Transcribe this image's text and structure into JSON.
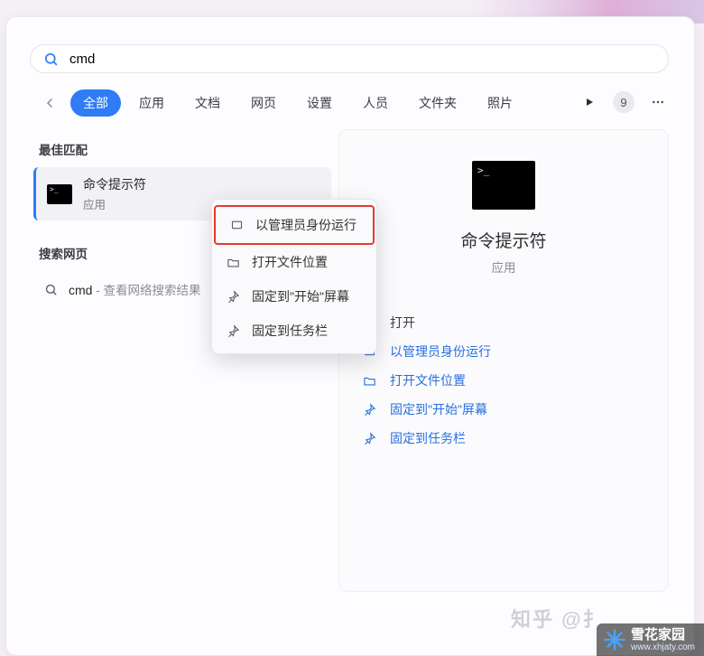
{
  "search": {
    "query": "cmd"
  },
  "filters": {
    "items": [
      "全部",
      "应用",
      "文档",
      "网页",
      "设置",
      "人员",
      "文件夹",
      "照片"
    ],
    "active_index": 0,
    "badge": "9"
  },
  "sections": {
    "best_match_title": "最佳匹配",
    "web_title": "搜索网页"
  },
  "best_match": {
    "title": "命令提示符",
    "subtitle": "应用"
  },
  "web_result": {
    "term": "cmd",
    "suffix": " - 查看网络搜索结果"
  },
  "context_menu": {
    "items": [
      {
        "icon": "admin-shield-icon",
        "label": "以管理员身份运行"
      },
      {
        "icon": "folder-icon",
        "label": "打开文件位置"
      },
      {
        "icon": "pin-icon",
        "label": "固定到\"开始\"屏幕"
      },
      {
        "icon": "pin-icon",
        "label": "固定到任务栏"
      }
    ],
    "highlight_index": 0
  },
  "detail": {
    "title": "命令提示符",
    "type": "应用",
    "actions": [
      {
        "icon": "",
        "label": "打开",
        "plain": true
      },
      {
        "icon": "admin-shield-icon",
        "label": "以管理员身份运行",
        "plain": false
      },
      {
        "icon": "folder-icon",
        "label": "打开文件位置",
        "plain": false
      },
      {
        "icon": "pin-icon",
        "label": "固定到\"开始\"屏幕",
        "plain": false
      },
      {
        "icon": "pin-icon",
        "label": "固定到任务栏",
        "plain": false
      }
    ]
  },
  "watermarks": {
    "zhihu": "知乎  @扌",
    "brand_name": "雪花家园",
    "brand_url": "www.xhjaty.com"
  }
}
